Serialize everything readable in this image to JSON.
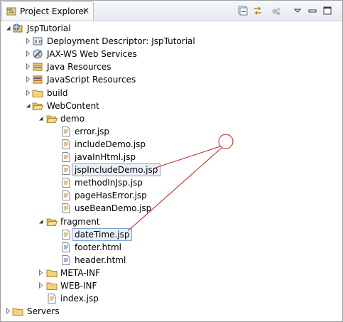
{
  "view": {
    "tab_title": "Project Explorer",
    "tab_icon": "project-explorer-icon",
    "close_icon": "close-icon",
    "toolbar": [
      "collapse-all-icon",
      "link-with-editor-icon",
      "focus-active-task-icon",
      "view-menu-icon",
      "minimize-icon",
      "maximize-icon"
    ]
  },
  "tree": [
    {
      "label": "JspTutorial",
      "icon": "web-project-icon",
      "state": "expanded",
      "level": 0
    },
    {
      "label": "Deployment Descriptor: JspTutorial",
      "icon": "deployment-descriptor-icon",
      "state": "collapsed",
      "level": 1
    },
    {
      "label": "JAX-WS Web Services",
      "icon": "web-services-icon",
      "state": "collapsed",
      "level": 1
    },
    {
      "label": "Java Resources",
      "icon": "java-resources-icon",
      "state": "collapsed",
      "level": 1
    },
    {
      "label": "JavaScript Resources",
      "icon": "javascript-resources-icon",
      "state": "collapsed",
      "level": 1
    },
    {
      "label": "build",
      "icon": "folder-icon",
      "state": "collapsed",
      "level": 1
    },
    {
      "label": "WebContent",
      "icon": "folder-open-icon",
      "state": "expanded",
      "level": 1
    },
    {
      "label": "demo",
      "icon": "folder-open-icon",
      "state": "expanded",
      "level": 2
    },
    {
      "label": "error.jsp",
      "icon": "jsp-file-icon",
      "state": "leaf",
      "level": 3
    },
    {
      "label": "includeDemo.jsp",
      "icon": "jsp-file-icon",
      "state": "leaf",
      "level": 3
    },
    {
      "label": "javaInHtml.jsp",
      "icon": "jsp-file-icon",
      "state": "leaf",
      "level": 3
    },
    {
      "label": "jspIncludeDemo.jsp",
      "icon": "jsp-file-icon",
      "state": "leaf",
      "level": 3,
      "highlighted": true
    },
    {
      "label": "methodInJsp.jsp",
      "icon": "jsp-file-icon",
      "state": "leaf",
      "level": 3
    },
    {
      "label": "pageHasError.jsp",
      "icon": "jsp-file-icon",
      "state": "leaf",
      "level": 3
    },
    {
      "label": "useBeanDemo.jsp",
      "icon": "jsp-file-icon",
      "state": "leaf",
      "level": 3
    },
    {
      "label": "fragment",
      "icon": "folder-open-icon",
      "state": "expanded",
      "level": 2
    },
    {
      "label": "dateTime.jsp",
      "icon": "jsp-file-icon",
      "state": "leaf",
      "level": 3,
      "highlighted": true
    },
    {
      "label": "footer.html",
      "icon": "html-file-icon",
      "state": "leaf",
      "level": 3
    },
    {
      "label": "header.html",
      "icon": "html-file-icon",
      "state": "leaf",
      "level": 3
    },
    {
      "label": "META-INF",
      "icon": "folder-icon",
      "state": "collapsed",
      "level": 2
    },
    {
      "label": "WEB-INF",
      "icon": "folder-icon",
      "state": "collapsed",
      "level": 2
    },
    {
      "label": "index.jsp",
      "icon": "jsp-file-icon",
      "state": "leaf",
      "level": 2
    },
    {
      "label": "Servers",
      "icon": "folder-icon",
      "state": "collapsed",
      "level": 0
    }
  ],
  "annotation": {
    "color": "#d01818",
    "marker": "annotation-circle"
  }
}
